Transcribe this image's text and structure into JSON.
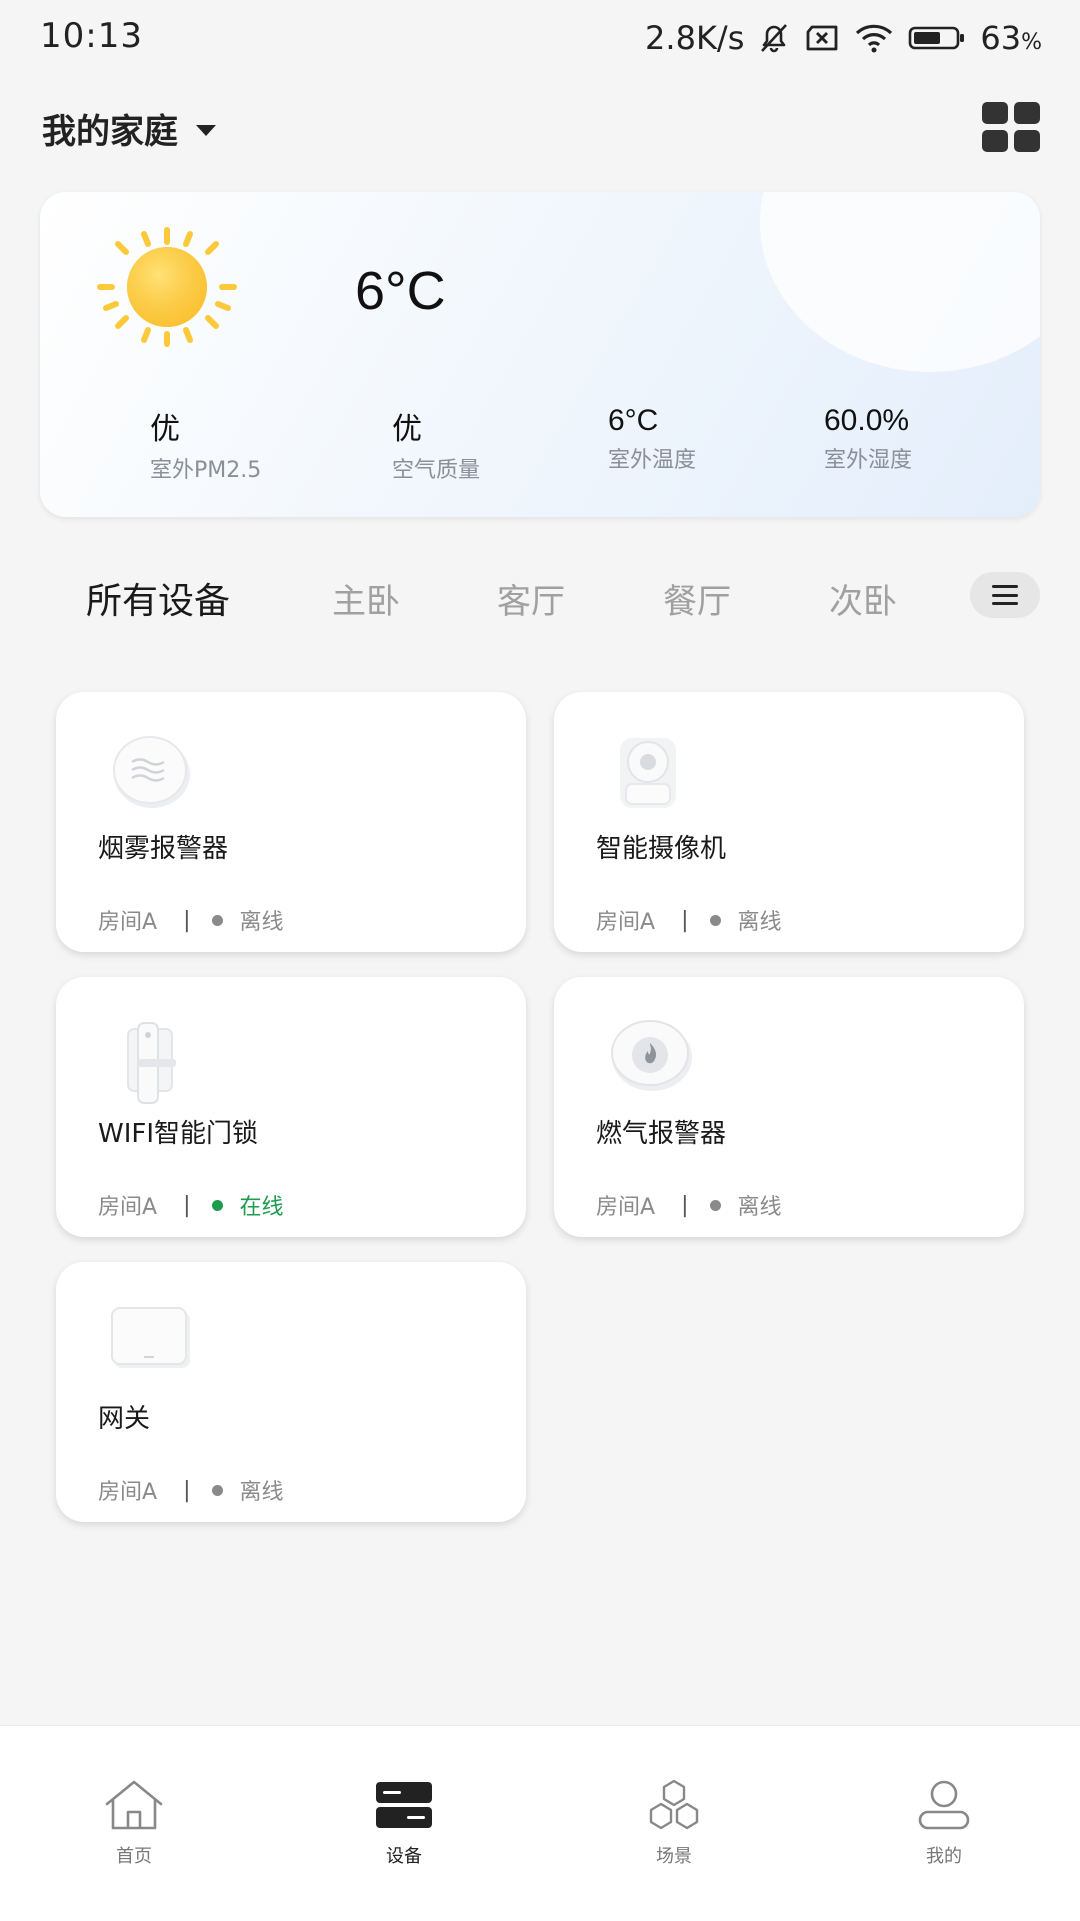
{
  "status_bar": {
    "time": "10:13",
    "net_speed": "2.8K/s",
    "battery_pct": "63",
    "battery_unit": "%",
    "icons": [
      "bell-off-icon",
      "sim-x-icon",
      "wifi-icon",
      "battery-icon"
    ]
  },
  "header": {
    "home_name": "我的家庭",
    "icons": [
      "caret-down-icon",
      "grid-view-icon"
    ]
  },
  "weather": {
    "temperature": "6°C",
    "icon": "sun-icon",
    "metrics": [
      {
        "value": "优",
        "label": "室外PM2.5"
      },
      {
        "value": "优",
        "label": "空气质量"
      },
      {
        "value": "6°C",
        "label": "室外温度"
      },
      {
        "value": "60.0%",
        "label": "室外湿度"
      }
    ]
  },
  "tabs": {
    "items": [
      "所有设备",
      "主卧",
      "客厅",
      "餐厅",
      "次卧"
    ],
    "active_index": 0,
    "menu_icon": "menu-icon"
  },
  "devices": [
    {
      "name": "烟雾报警器",
      "room": "房间A",
      "status": "离线",
      "online": false,
      "icon": "smoke-detector-icon"
    },
    {
      "name": "智能摄像机",
      "room": "房间A",
      "status": "离线",
      "online": false,
      "icon": "camera-icon"
    },
    {
      "name": "WIFI智能门锁",
      "room": "房间A",
      "status": "在线",
      "online": true,
      "icon": "door-lock-icon"
    },
    {
      "name": "燃气报警器",
      "room": "房间A",
      "status": "离线",
      "online": false,
      "icon": "gas-detector-icon"
    },
    {
      "name": "网关",
      "room": "房间A",
      "status": "离线",
      "online": false,
      "icon": "gateway-icon"
    }
  ],
  "bottom_nav": {
    "items": [
      {
        "label": "首页",
        "icon": "home-icon"
      },
      {
        "label": "设备",
        "icon": "devices-icon"
      },
      {
        "label": "场景",
        "icon": "scene-icon"
      },
      {
        "label": "我的",
        "icon": "profile-icon"
      }
    ],
    "active_index": 1
  },
  "colors": {
    "online": "#1f9b50",
    "offline": "#8a8a8a",
    "sun": "#fcc93a",
    "background": "#f5f5f5"
  }
}
